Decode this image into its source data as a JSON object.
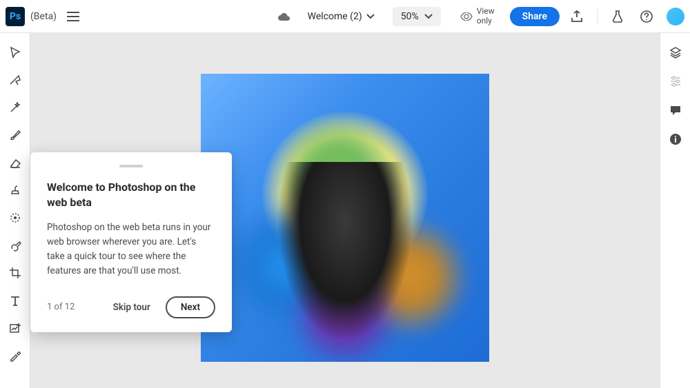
{
  "header": {
    "app_short": "Ps",
    "beta_label": "(Beta)",
    "document_name": "Welcome (2)",
    "zoom": "50%",
    "view_only_line1": "View",
    "view_only_line2": "only",
    "share_label": "Share"
  },
  "toolbar": {
    "tools": [
      "move",
      "lasso",
      "magic-wand",
      "brush",
      "eraser",
      "clone-stamp",
      "spot-heal",
      "gradient",
      "crop",
      "type",
      "add-image",
      "eyedropper"
    ]
  },
  "right_panel": {
    "items": [
      "layers",
      "properties",
      "comments",
      "info"
    ]
  },
  "tour": {
    "title": "Welcome to Photoshop on the web beta",
    "body": "Photoshop on the web beta runs in your web browser wherever you are. Let's take a quick tour to see where the features are that you'll use most.",
    "step": "1 of 12",
    "skip_label": "Skip tour",
    "next_label": "Next"
  }
}
